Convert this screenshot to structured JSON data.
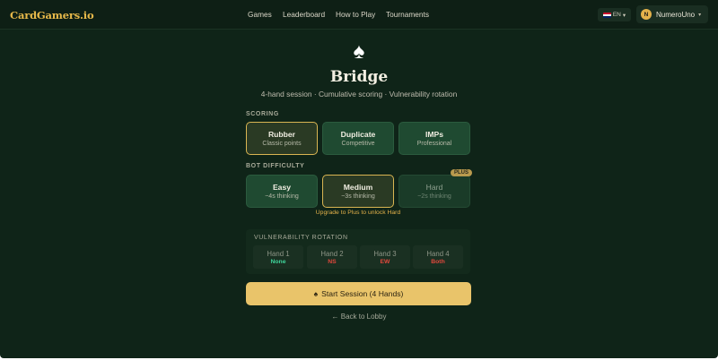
{
  "header": {
    "logo": "CardGamers.io",
    "nav": [
      "Games",
      "Leaderboard",
      "How to Play",
      "Tournaments"
    ],
    "language": "EN",
    "language_caret": "▾",
    "user": {
      "initial": "N",
      "name": "NumeroUno",
      "caret": "▾"
    }
  },
  "hero": {
    "icon": "spade-icon",
    "spade_glyph": "♠",
    "title": "Bridge",
    "subtitle": "4-hand session · Cumulative scoring · Vulnerability rotation"
  },
  "scoring": {
    "label": "SCORING",
    "options": [
      {
        "name": "Rubber",
        "desc": "Classic points",
        "selected": true
      },
      {
        "name": "Duplicate",
        "desc": "Competitive",
        "selected": false
      },
      {
        "name": "IMPs",
        "desc": "Professional",
        "selected": false
      }
    ]
  },
  "difficulty": {
    "label": "BOT DIFFICULTY",
    "options": [
      {
        "name": "Easy",
        "desc": "~4s thinking",
        "selected": false,
        "locked": false
      },
      {
        "name": "Medium",
        "desc": "~3s thinking",
        "selected": true,
        "locked": false
      },
      {
        "name": "Hard",
        "desc": "~2s thinking",
        "selected": false,
        "locked": true,
        "badge": "PLUS"
      }
    ],
    "upgrade_note": "Upgrade to Plus to unlock Hard"
  },
  "vulnerability": {
    "label": "VULNERABILITY ROTATION",
    "hands": [
      {
        "hand": "Hand 1",
        "value": "None",
        "color": "#3fd39a"
      },
      {
        "hand": "Hand 2",
        "value": "NS",
        "color": "#e0483c"
      },
      {
        "hand": "Hand 3",
        "value": "EW",
        "color": "#e0483c"
      },
      {
        "hand": "Hand 4",
        "value": "Both",
        "color": "#e0483c"
      }
    ]
  },
  "actions": {
    "start_icon": "♠",
    "start_label": "Start Session (4 Hands)",
    "back_label": "← Back to Lobby"
  },
  "colors": {
    "background": "#0f2418",
    "accent": "#e9c46a",
    "card": "#1f4a31"
  }
}
